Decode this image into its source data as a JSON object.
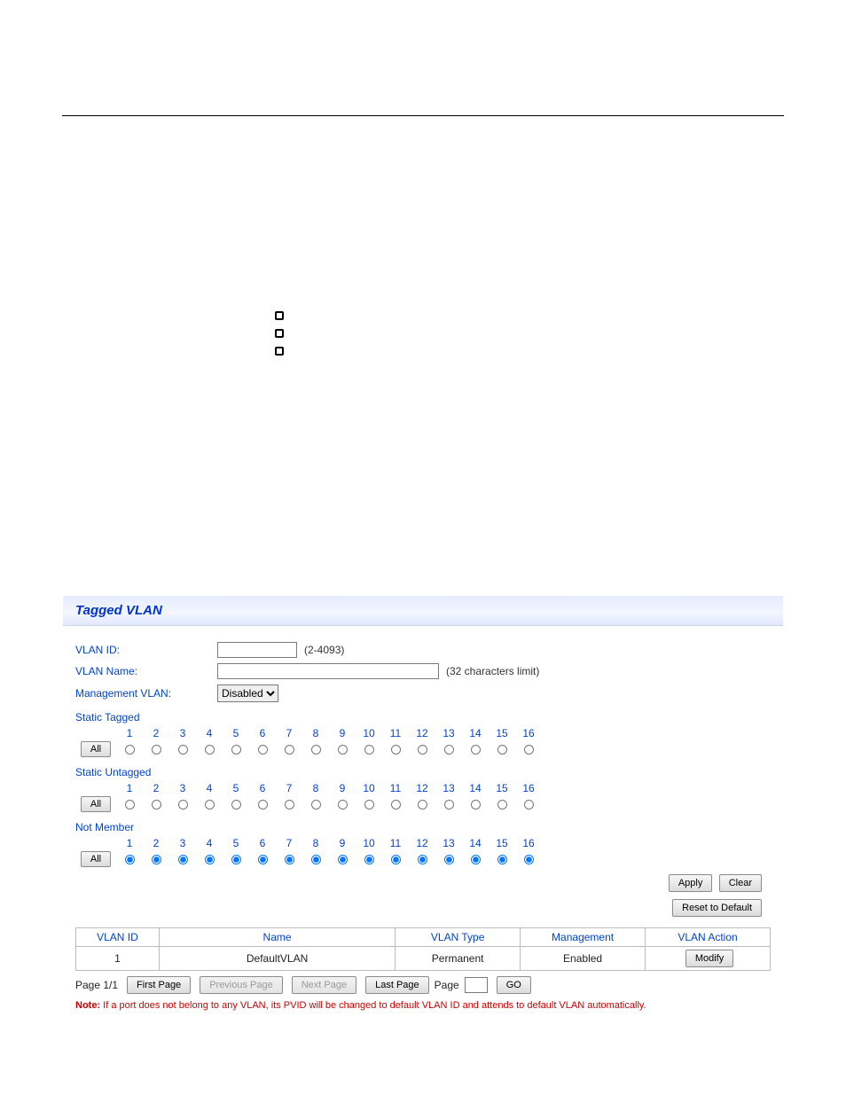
{
  "bullets": [
    "",
    "",
    ""
  ],
  "panel": {
    "title": "Tagged VLAN",
    "form": {
      "vlan_id_label": "VLAN ID:",
      "vlan_id_value": "",
      "vlan_id_hint": "(2-4093)",
      "vlan_name_label": "VLAN Name:",
      "vlan_name_value": "",
      "vlan_name_hint": "(32 characters limit)",
      "mgmt_label": "Management VLAN:",
      "mgmt_value": "Disabled"
    },
    "sections": {
      "static_tagged": "Static Tagged",
      "static_untagged": "Static Untagged",
      "not_member": "Not Member",
      "all_button": "All"
    },
    "port_headers": [
      "1",
      "2",
      "3",
      "4",
      "5",
      "6",
      "7",
      "8",
      "9",
      "10",
      "11",
      "12",
      "13",
      "14",
      "15",
      "16"
    ],
    "buttons": {
      "apply": "Apply",
      "clear": "Clear",
      "reset": "Reset to Default",
      "modify": "Modify",
      "first": "First Page",
      "prev": "Previous Page",
      "next": "Next Page",
      "last": "Last Page",
      "go": "GO"
    },
    "table": {
      "headers": {
        "vlan_id": "VLAN ID",
        "name": "Name",
        "vlan_type": "VLAN Type",
        "management": "Management",
        "vlan_action": "VLAN Action"
      },
      "rows": [
        {
          "vlan_id": "1",
          "name": "DefaultVLAN",
          "vlan_type": "Permanent",
          "management": "Enabled"
        }
      ]
    },
    "pager": {
      "page_label_prefix": "Page ",
      "page_label_value": "1/1",
      "page_field_label": "Page",
      "page_field_value": ""
    },
    "note_prefix": "Note: ",
    "note_text": "If a port does not belong to any VLAN, its PVID will be changed to default VLAN ID and attends to default VLAN automatically."
  }
}
